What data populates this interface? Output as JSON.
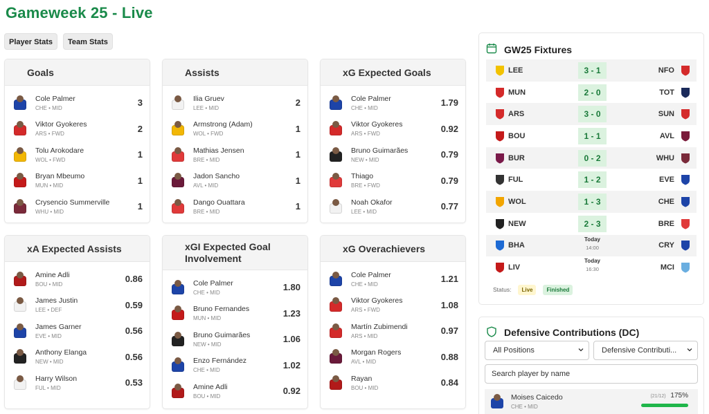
{
  "page": {
    "title": "Gameweek 25 - Live"
  },
  "tabs": [
    "Player Stats",
    "Team Stats"
  ],
  "colors": {
    "accent": "#1a8a4a",
    "score_bg": "#dbf2df",
    "live_bg": "#fff6cf"
  },
  "cards": [
    {
      "title": "Goals",
      "players": [
        {
          "name": "Cole Palmer",
          "meta": "CHE • MID",
          "value": "3",
          "kit": "#1d44a8"
        },
        {
          "name": "Viktor Gyokeres",
          "meta": "ARS • FWD",
          "value": "2",
          "kit": "#d42a2a"
        },
        {
          "name": "Tolu Arokodare",
          "meta": "WOL • FWD",
          "value": "1",
          "kit": "#f2b705"
        },
        {
          "name": "Bryan Mbeumo",
          "meta": "MUN • MID",
          "value": "1",
          "kit": "#c41a1a"
        },
        {
          "name": "Crysencio Summerville",
          "meta": "WHU • MID",
          "value": "1",
          "kit": "#7a2a3a"
        }
      ]
    },
    {
      "title": "Assists",
      "players": [
        {
          "name": "Ilia Gruev",
          "meta": "LEE • MID",
          "value": "2",
          "kit": "#f2f2f2"
        },
        {
          "name": "Armstrong (Adam)",
          "meta": "WOL • FWD",
          "value": "1",
          "kit": "#f2b705"
        },
        {
          "name": "Mathias Jensen",
          "meta": "BRE • MID",
          "value": "1",
          "kit": "#e03a3a"
        },
        {
          "name": "Jadon Sancho",
          "meta": "AVL • MID",
          "value": "1",
          "kit": "#6a1a3a"
        },
        {
          "name": "Dango Ouattara",
          "meta": "BRE • MID",
          "value": "1",
          "kit": "#e03a3a"
        }
      ]
    },
    {
      "title": "xG Expected Goals",
      "players": [
        {
          "name": "Cole Palmer",
          "meta": "CHE • MID",
          "value": "1.79",
          "kit": "#1d44a8"
        },
        {
          "name": "Viktor Gyokeres",
          "meta": "ARS • FWD",
          "value": "0.92",
          "kit": "#d42a2a"
        },
        {
          "name": "Bruno Guimarães",
          "meta": "NEW • MID",
          "value": "0.79",
          "kit": "#222222"
        },
        {
          "name": "Thiago",
          "meta": "BRE • FWD",
          "value": "0.79",
          "kit": "#e03a3a"
        },
        {
          "name": "Noah Okafor",
          "meta": "LEE • MID",
          "value": "0.77",
          "kit": "#f2f2f2"
        }
      ]
    },
    {
      "title": "xA Expected Assists",
      "players": [
        {
          "name": "Amine Adli",
          "meta": "BOU • MID",
          "value": "0.86",
          "kit": "#b11a1a"
        },
        {
          "name": "James Justin",
          "meta": "LEE • DEF",
          "value": "0.59",
          "kit": "#f2f2f2"
        },
        {
          "name": "James Garner",
          "meta": "EVE • MID",
          "value": "0.56",
          "kit": "#1d44a8"
        },
        {
          "name": "Anthony Elanga",
          "meta": "NEW • MID",
          "value": "0.56",
          "kit": "#222222"
        },
        {
          "name": "Harry Wilson",
          "meta": "FUL • MID",
          "value": "0.53",
          "kit": "#f2f2f2"
        }
      ]
    },
    {
      "title": "xGI Expected Goal Involvement",
      "players": [
        {
          "name": "Cole Palmer",
          "meta": "CHE • MID",
          "value": "1.80",
          "kit": "#1d44a8"
        },
        {
          "name": "Bruno Fernandes",
          "meta": "MUN • MID",
          "value": "1.23",
          "kit": "#c41a1a"
        },
        {
          "name": "Bruno Guimarães",
          "meta": "NEW • MID",
          "value": "1.06",
          "kit": "#222222"
        },
        {
          "name": "Enzo Fernández",
          "meta": "CHE • MID",
          "value": "1.02",
          "kit": "#1d44a8"
        },
        {
          "name": "Amine Adli",
          "meta": "BOU • MID",
          "value": "0.92",
          "kit": "#b11a1a"
        }
      ]
    },
    {
      "title": "xG Overachievers",
      "players": [
        {
          "name": "Cole Palmer",
          "meta": "CHE • MID",
          "value": "1.21",
          "kit": "#1d44a8"
        },
        {
          "name": "Viktor Gyokeres",
          "meta": "ARS • FWD",
          "value": "1.08",
          "kit": "#d42a2a"
        },
        {
          "name": "Martín Zubimendi",
          "meta": "ARS • MID",
          "value": "0.97",
          "kit": "#d42a2a"
        },
        {
          "name": "Morgan Rogers",
          "meta": "AVL • MID",
          "value": "0.88",
          "kit": "#6a1a3a"
        },
        {
          "name": "Rayan",
          "meta": "BOU • MID",
          "value": "0.84",
          "kit": "#b11a1a"
        }
      ]
    }
  ],
  "fixtures": {
    "title": "GW25 Fixtures",
    "matches": [
      {
        "home": "LEE",
        "away": "NFO",
        "score": "3 - 1",
        "home_color": "#f2c200",
        "away_color": "#d42a2a"
      },
      {
        "home": "MUN",
        "away": "TOT",
        "score": "2 - 0",
        "home_color": "#d42a2a",
        "away_color": "#1a2a5a"
      },
      {
        "home": "ARS",
        "away": "SUN",
        "score": "3 - 0",
        "home_color": "#d42a2a",
        "away_color": "#d42a2a"
      },
      {
        "home": "BOU",
        "away": "AVL",
        "score": "1 - 1",
        "home_color": "#c41a1a",
        "away_color": "#7a1a3a"
      },
      {
        "home": "BUR",
        "away": "WHU",
        "score": "0 - 2",
        "home_color": "#7a1a4a",
        "away_color": "#7a2a3a"
      },
      {
        "home": "FUL",
        "away": "EVE",
        "score": "1 - 2",
        "home_color": "#333333",
        "away_color": "#1d44a8"
      },
      {
        "home": "WOL",
        "away": "CHE",
        "score": "1 - 3",
        "home_color": "#f2a500",
        "away_color": "#1d44a8"
      },
      {
        "home": "NEW",
        "away": "BRE",
        "score": "2 - 3",
        "home_color": "#222222",
        "away_color": "#e03a3a"
      },
      {
        "home": "BHA",
        "away": "CRY",
        "date": "Today",
        "time": "14:00",
        "home_color": "#1d6ad4",
        "away_color": "#1d44a8"
      },
      {
        "home": "LIV",
        "away": "MCI",
        "date": "Today",
        "time": "16:30",
        "home_color": "#c41a1a",
        "away_color": "#6aaee0"
      }
    ],
    "status_label": "Status:",
    "status_live": "Live",
    "status_finished": "Finished"
  },
  "defensive": {
    "title": "Defensive Contributions (DC)",
    "position_select": "All Positions",
    "metric_select": "Defensive Contributi...",
    "search_placeholder": "Search player by name",
    "top_player": {
      "name": "Moises Caicedo",
      "meta": "CHE • MID",
      "ratio": "(21/12)",
      "percent": "175%",
      "fill_fraction": 1.0,
      "kit": "#1d44a8"
    }
  }
}
